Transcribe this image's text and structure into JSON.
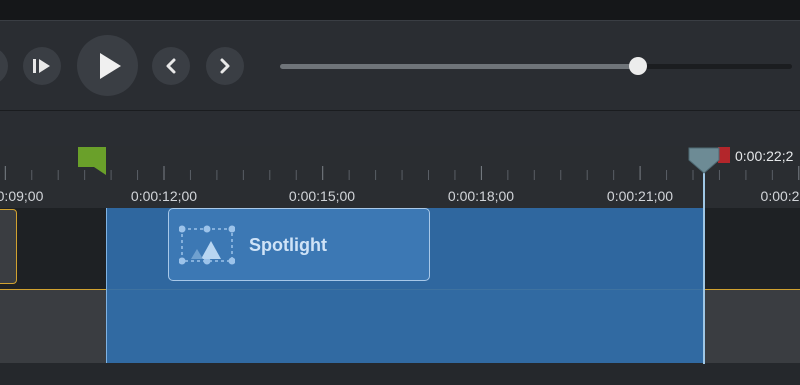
{
  "player": {
    "buttons": [
      "step-back",
      "next-frame",
      "play",
      "previous",
      "next"
    ],
    "scrub_progress_percent": 70
  },
  "timeline": {
    "playhead_time": "0:00:22;2",
    "ruler_labels": [
      "0:09;00",
      "0:00:12;00",
      "0:00:15;00",
      "0:00:18;00",
      "0:00:21;00",
      "0:00:2"
    ],
    "clip": {
      "label": "Spotlight"
    }
  },
  "colors": {
    "selection": "#316eaa",
    "clip": "#3c78b4",
    "in_marker": "#6aa02a",
    "out_marker": "#b3262b",
    "track_outline": "#d1a230"
  }
}
